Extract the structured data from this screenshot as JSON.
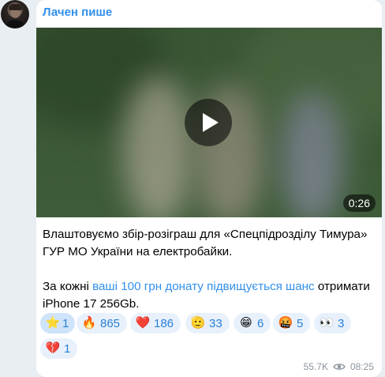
{
  "post": {
    "author": "Лачен пише",
    "video": {
      "duration": "0:26"
    },
    "text": {
      "line1": "Влаштовуємо збір-розіграш для «Спецпідрозділу Тимура» ГУР МО України на електробайки.",
      "line2_prefix": "За кожні ",
      "line2_link": "ваші 100 грн донату підвищується шанс",
      "line2_suffix": " отримати iPhone 17 256Gb."
    },
    "reactions": [
      {
        "emoji": "⭐",
        "count": "1",
        "icon": "star-icon"
      },
      {
        "emoji": "🔥",
        "count": "865",
        "icon": "fire-icon"
      },
      {
        "emoji": "❤️",
        "count": "186",
        "icon": "heart-icon"
      },
      {
        "emoji": "🫡",
        "count": "33",
        "icon": "salute-icon"
      },
      {
        "emoji": "😁",
        "count": "6",
        "icon": "grin-icon"
      },
      {
        "emoji": "🤬",
        "count": "5",
        "icon": "angry-icon"
      },
      {
        "emoji": "👀",
        "count": "3",
        "icon": "eyes-icon"
      },
      {
        "emoji": "💔",
        "count": "1",
        "icon": "broken-heart-icon"
      }
    ],
    "views": "55.7K",
    "time": "08:25"
  },
  "colors": {
    "accent": "#3390ec",
    "reaction_bg": "#e8f1fb",
    "background": "#e9eef3"
  }
}
